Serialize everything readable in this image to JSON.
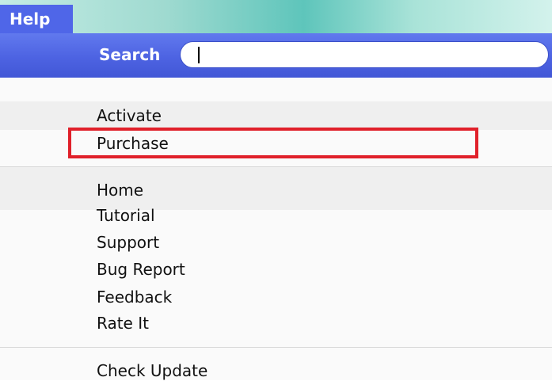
{
  "menubar": {
    "title": "Help"
  },
  "search": {
    "label": "Search",
    "value": ""
  },
  "menu": {
    "group1": [
      "Activate",
      "Purchase"
    ],
    "group2": [
      "Home",
      "Tutorial",
      "Support",
      "Bug Report",
      "Feedback",
      "Rate It"
    ],
    "group3": [
      "Check Update"
    ]
  },
  "highlighted_item": "Purchase",
  "colors": {
    "menu_blue": "#4f66e8",
    "highlight_red": "#e0202a"
  }
}
